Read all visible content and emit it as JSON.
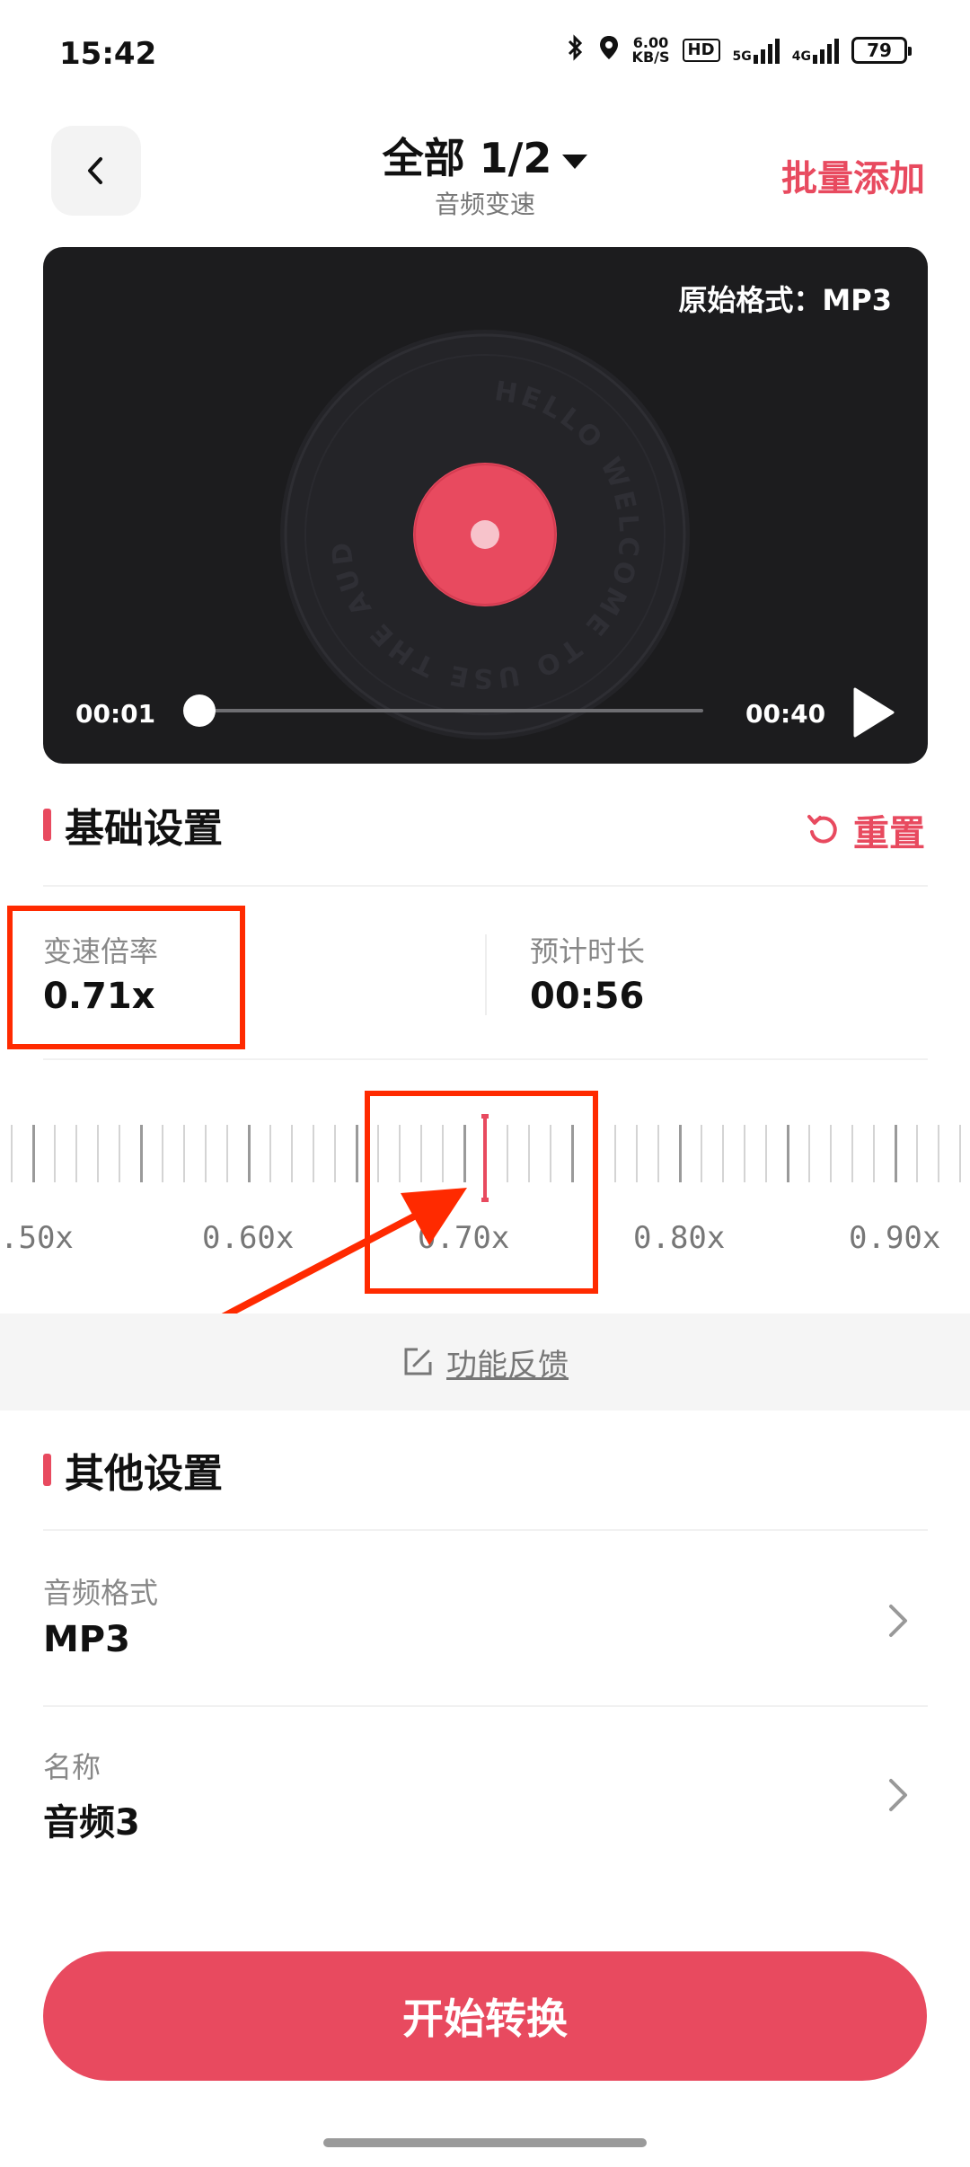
{
  "status_bar": {
    "time": "15:42",
    "net_speed_value": "6.00",
    "net_speed_unit": "KB/S",
    "hd_label": "HD",
    "sim1_label": "5G",
    "sim2_label": "4G",
    "battery": "79"
  },
  "header": {
    "title": "全部 1/2",
    "subtitle": "音频变速",
    "batch_add_label": "批量添加"
  },
  "player": {
    "format_label": "原始格式：MP3",
    "disc_text": "HELLO WELCOME TO USE THE AUDIO CONVERTER",
    "current_time": "00:01",
    "total_time": "00:40",
    "progress": 0.025,
    "accent_color": "#e84a5f"
  },
  "basic_settings": {
    "title": "基础设置",
    "reset_label": "重置",
    "speed_label": "变速倍率",
    "speed_value": "0.71x",
    "duration_label": "预计时长",
    "duration_value": "00:56",
    "ruler_labels": [
      ".50x",
      "0.60x",
      "0.70x",
      "0.80x",
      "0.90x"
    ],
    "ruler_value": 0.71
  },
  "feedback": {
    "label": "功能反馈"
  },
  "other_settings": {
    "title": "其他设置",
    "rows": [
      {
        "label": "音频格式",
        "value": "MP3"
      },
      {
        "label": "名称",
        "value": "音频3"
      }
    ]
  },
  "start_button": {
    "label": "开始转换"
  },
  "colors": {
    "accent": "#e84a5f",
    "annotation": "#ff2a00"
  }
}
